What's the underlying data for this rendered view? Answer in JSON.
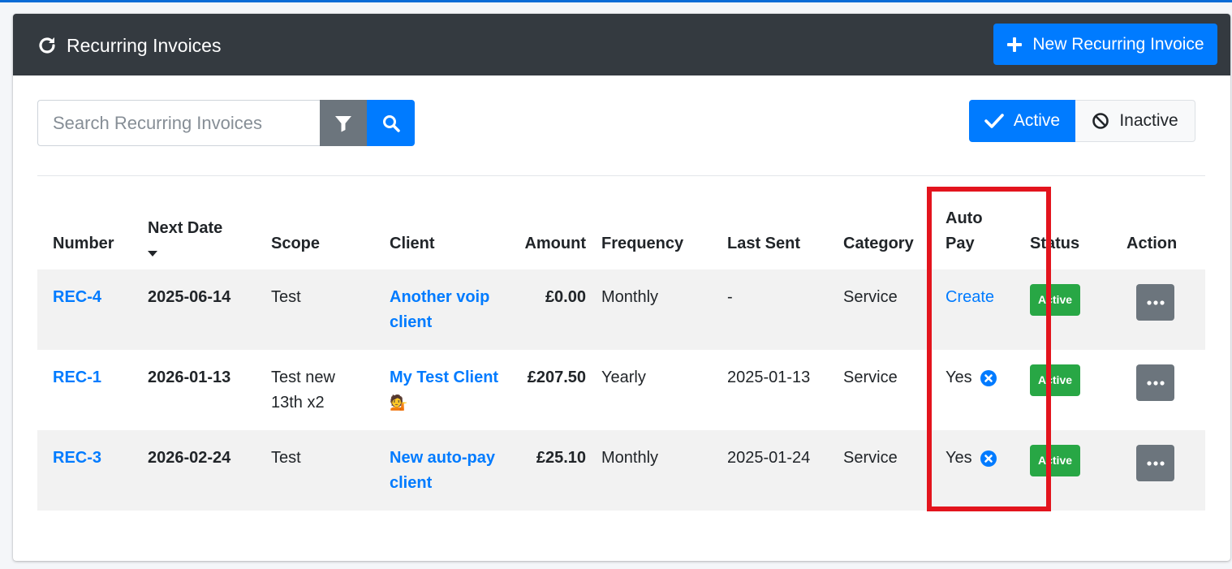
{
  "header": {
    "title": "Recurring Invoices",
    "new_button_label": "New Recurring Invoice"
  },
  "search": {
    "placeholder": "Search Recurring Invoices",
    "value": ""
  },
  "toggles": {
    "active_label": "Active",
    "inactive_label": "Inactive"
  },
  "table": {
    "columns": {
      "number": "Number",
      "next_date": "Next Date",
      "scope": "Scope",
      "client": "Client",
      "amount": "Amount",
      "frequency": "Frequency",
      "last_sent": "Last Sent",
      "category": "Category",
      "auto_pay_1": "Auto",
      "auto_pay_2": "Pay",
      "status": "Status",
      "action": "Action"
    },
    "rows": [
      {
        "number": "REC-4",
        "next_date": "2025-06-14",
        "scope": "Test",
        "client_1": "Another voip",
        "client_2": "client",
        "amount": "£0.00",
        "frequency": "Monthly",
        "last_sent": "-",
        "category": "Service",
        "auto_pay": "Create",
        "status": "Active"
      },
      {
        "number": "REC-1",
        "next_date": "2026-01-13",
        "scope_1": "Test new",
        "scope_2": "13th x2",
        "client_1": "My Test Client",
        "client_emoji": "💁",
        "amount": "£207.50",
        "frequency": "Yearly",
        "last_sent": "2025-01-13",
        "category": "Service",
        "auto_pay": "Yes",
        "status": "Active"
      },
      {
        "number": "REC-3",
        "next_date": "2026-02-24",
        "scope": "Test",
        "client_1": "New auto-pay",
        "client_2": "client",
        "amount": "£25.10",
        "frequency": "Monthly",
        "last_sent": "2025-01-24",
        "category": "Service",
        "auto_pay": "Yes",
        "status": "Active"
      }
    ]
  },
  "colors": {
    "primary": "#007bff",
    "header_bg": "#343a40",
    "success": "#28a745",
    "secondary": "#6c757d",
    "highlight": "#e3141d"
  },
  "icons": {
    "title": "refresh-icon",
    "new": "plus-icon",
    "filter": "filter-icon",
    "search": "search-icon",
    "active": "check-icon",
    "inactive": "ban-icon",
    "auto_pay_cancel": "times-circle-icon",
    "action": "ellipsis-icon"
  }
}
